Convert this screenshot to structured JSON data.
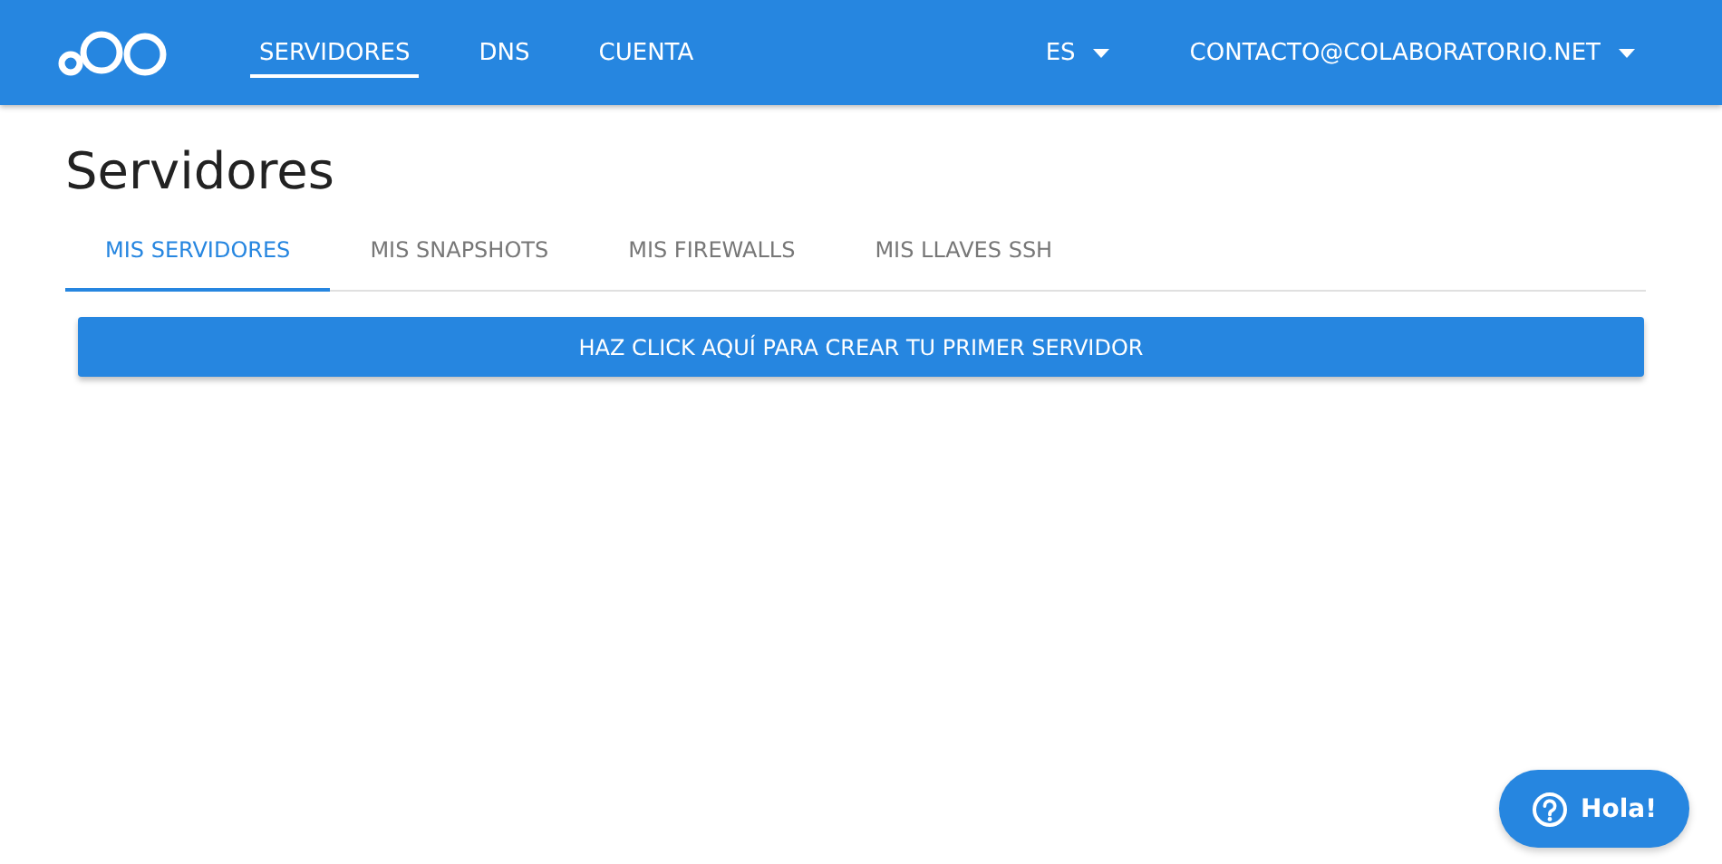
{
  "nav": {
    "items": [
      {
        "label": "SERVIDORES",
        "selected": true
      },
      {
        "label": "DNS",
        "selected": false
      },
      {
        "label": "CUENTA",
        "selected": false
      }
    ],
    "language": "ES",
    "account": "CONTACTO@COLABORATORIO.NET"
  },
  "page_title": "Servidores",
  "tabs": [
    {
      "label": "MIS SERVIDORES",
      "selected": true
    },
    {
      "label": "MIS SNAPSHOTS",
      "selected": false
    },
    {
      "label": "MIS FIREWALLS",
      "selected": false
    },
    {
      "label": "MIS LLAVES SSH",
      "selected": false
    }
  ],
  "create_button": "HAZ CLICK AQUÍ PARA CREAR TU PRIMER SERVIDOR",
  "help_button": "Hola!"
}
